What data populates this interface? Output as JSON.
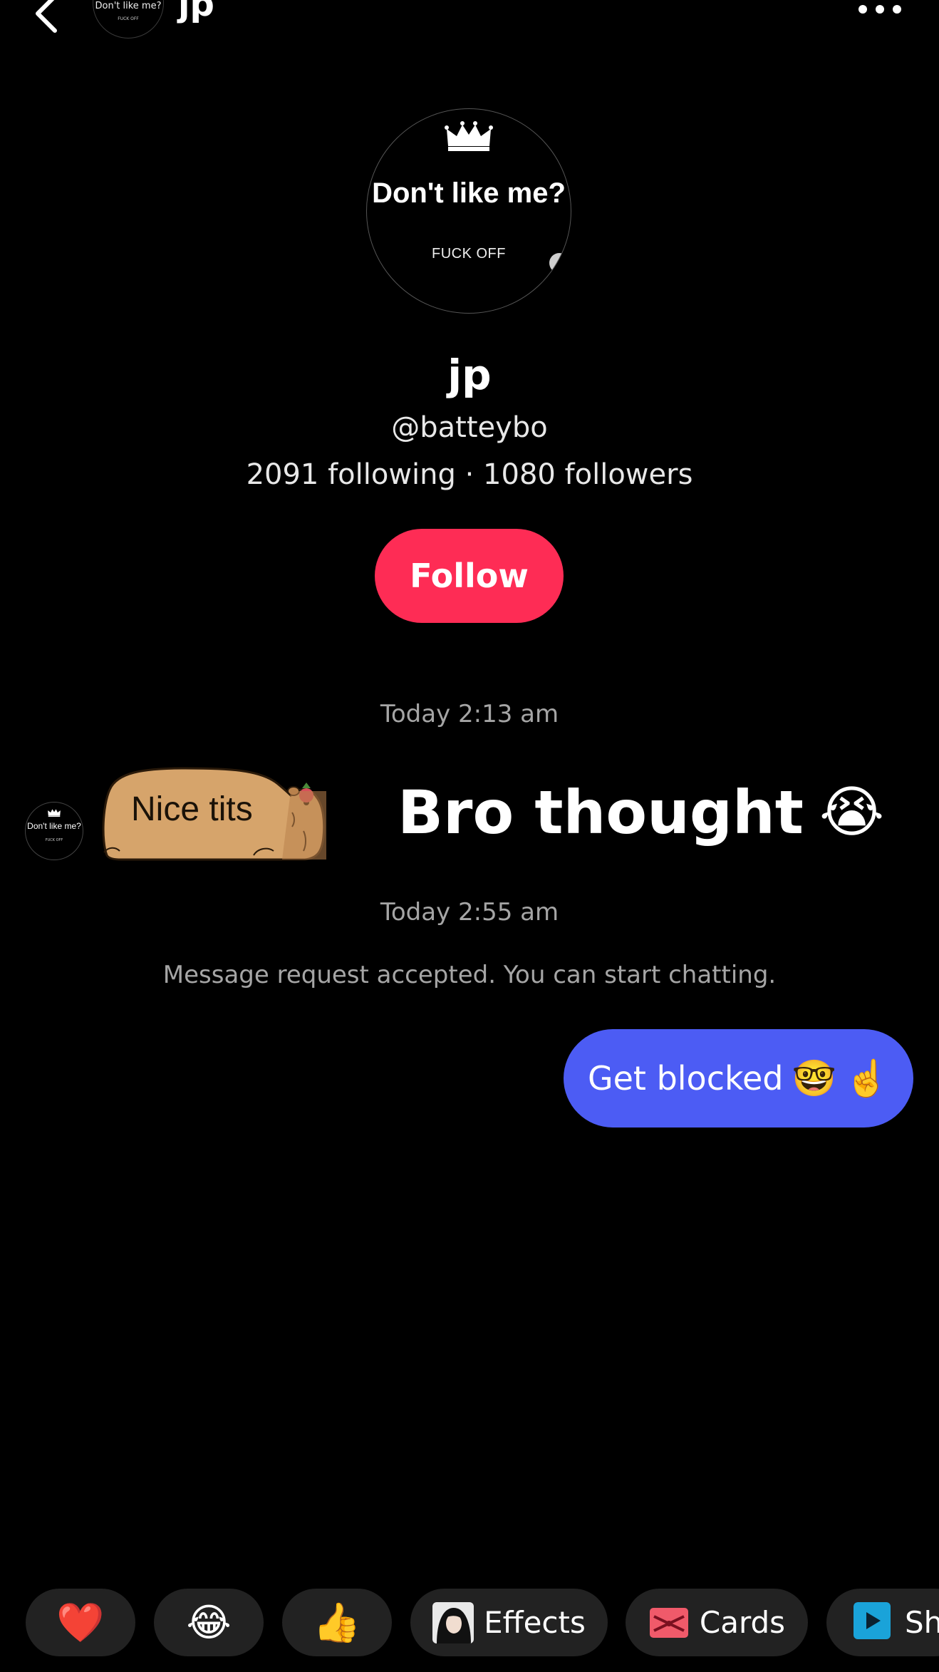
{
  "header": {
    "name": "jp",
    "avatar_text_line1": "Don't like me?",
    "avatar_text_line2": "FUCK OFF"
  },
  "profile": {
    "avatar_text_line1": "Don't like me?",
    "avatar_text_line2": "FUCK OFF",
    "name": "jp",
    "handle": "@batteybo",
    "stats": "2091 following · 1080 followers",
    "follow_label": "Follow"
  },
  "chat": {
    "timestamp_1": "Today 2:13 am",
    "sender_avatar_line1": "Don't like me?",
    "sender_avatar_line2": "FUCK OFF",
    "sticker_text": "Nice tits",
    "message_text": "Bro thought",
    "message_emoji": "😭",
    "timestamp_2": "Today 2:55 am",
    "system_message": "Message request accepted. You can start chatting.",
    "outgoing_text": "Get blocked",
    "outgoing_emoji_1": "🤓",
    "outgoing_emoji_2": "☝️"
  },
  "quick_bar": {
    "heart": "❤️",
    "laugh": "😂",
    "thumbs_up": "👍",
    "effects_label": "Effects",
    "cards_label": "Cards",
    "share_label": "Sh"
  },
  "colors": {
    "follow_button": "#fe2c55",
    "outgoing_bubble": "#4c5cf4",
    "chip_background": "#222222",
    "muted_text": "#a5a5a5",
    "cards_icon": "#f05a6a",
    "share_icon": "#1aa3d9"
  }
}
